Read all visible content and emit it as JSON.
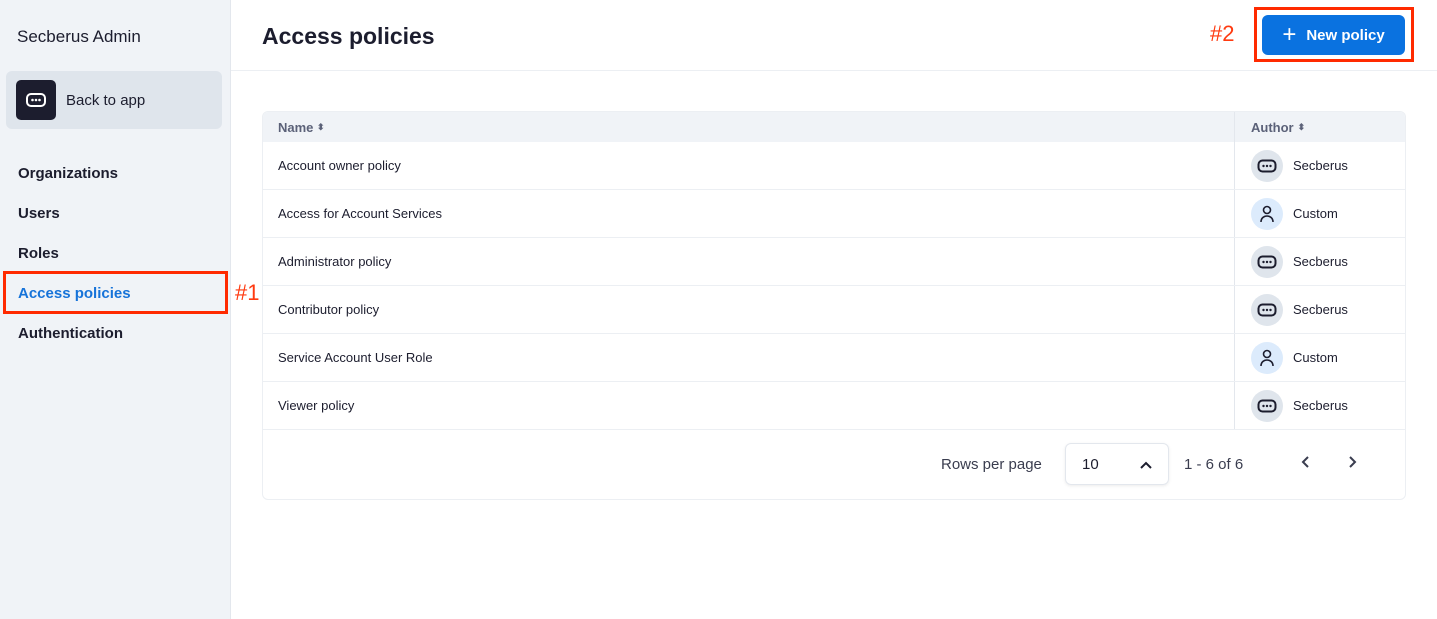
{
  "sidebar": {
    "brand": "Secberus Admin",
    "back": "Back to app",
    "items": [
      {
        "label": "Organizations"
      },
      {
        "label": "Users"
      },
      {
        "label": "Roles"
      },
      {
        "label": "Access policies",
        "active": true
      },
      {
        "label": "Authentication"
      }
    ]
  },
  "annotations": {
    "a1": "#1",
    "a2": "#2"
  },
  "header": {
    "title": "Access policies",
    "new_button": "New policy"
  },
  "table": {
    "columns": [
      "Name",
      "Author"
    ],
    "rows": [
      {
        "name": "Account owner policy",
        "author": "Secberus",
        "icon": "secberus-logo-icon"
      },
      {
        "name": "Access for Account Services",
        "author": "Custom",
        "icon": "user-icon"
      },
      {
        "name": "Administrator policy",
        "author": "Secberus",
        "icon": "secberus-logo-icon"
      },
      {
        "name": "Contributor policy",
        "author": "Secberus",
        "icon": "secberus-logo-icon"
      },
      {
        "name": "Service Account User Role",
        "author": "Custom",
        "icon": "user-icon"
      },
      {
        "name": "Viewer policy",
        "author": "Secberus",
        "icon": "secberus-logo-icon"
      }
    ]
  },
  "pagination": {
    "rows_label": "Rows per page",
    "rows_value": "10",
    "range": "1 - 6 of 6"
  },
  "colors": {
    "accent": "#0a72e0",
    "annotation": "#ff2a00"
  }
}
